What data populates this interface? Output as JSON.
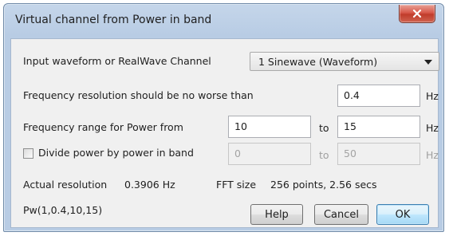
{
  "window": {
    "title": "Virtual channel from Power in band"
  },
  "input_waveform": {
    "label": "Input waveform or RealWave Channel",
    "selected": "1 Sinewave (Waveform)"
  },
  "resolution": {
    "label": "Frequency resolution should be no worse than",
    "value": "0.4",
    "unit": "Hz"
  },
  "range": {
    "label": "Frequency range for Power from",
    "from": "10",
    "to_label": "to",
    "to": "15",
    "unit": "Hz"
  },
  "divide": {
    "label": "Divide power by power in band",
    "checked": false,
    "from": "0",
    "to_label": "to",
    "to": "50",
    "unit": "Hz"
  },
  "info": {
    "actual_label": "Actual resolution",
    "actual_value": "0.3906 Hz",
    "fft_label": "FFT size",
    "fft_value": "256 points, 2.56 secs"
  },
  "expression": "Pw(1,0.4,10,15)",
  "buttons": {
    "help": "Help",
    "cancel": "Cancel",
    "ok": "OK"
  }
}
